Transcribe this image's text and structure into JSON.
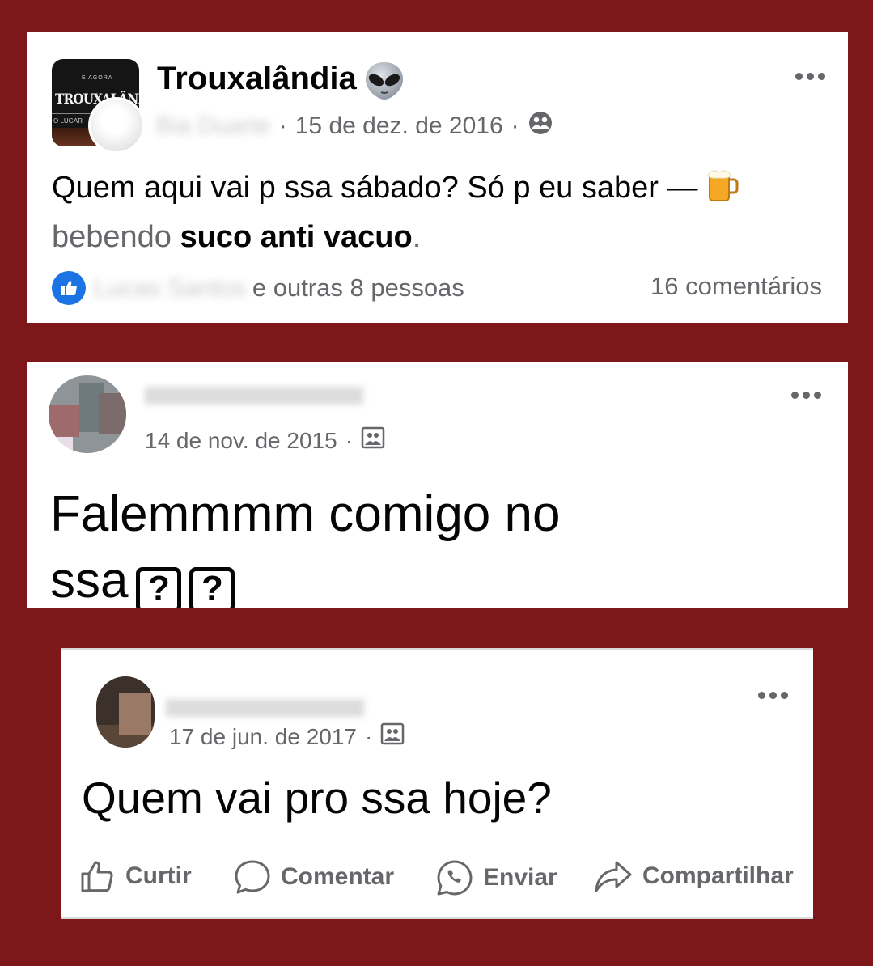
{
  "post1": {
    "page_name": "Trouxalândia",
    "page_emoji": "alien-emoji",
    "avatar_text": {
      "top": "E AGORA",
      "main": "TROUXALÂNDIA",
      "bottom": "O LUGAR"
    },
    "author": "Bia Duarte",
    "date": "15 de dez. de 2016",
    "separator": "·",
    "privacy_icon": "friends-icon",
    "text_main": "Quem aqui vai p ssa sábado? Só p eu saber —",
    "text_activity": "bebendo",
    "text_drink": "suco anti vacuo",
    "text_end": ".",
    "reactions_name": "Lucas Santos",
    "reactions_rest": "e outras 8 pessoas",
    "comments": "16 comentários"
  },
  "post2": {
    "date": "14 de nov. de 2015",
    "separator": "·",
    "privacy_icon": "group-icon",
    "text_line1": "Falemmmm comigo no",
    "text_line2": "ssa",
    "unknown_glyph": "?"
  },
  "post3": {
    "date": "17 de jun. de 2017",
    "separator": "·",
    "privacy_icon": "group-icon",
    "text": "Quem vai pro ssa hoje?",
    "actions": {
      "like": "Curtir",
      "comment": "Comentar",
      "send": "Enviar",
      "share": "Compartilhar"
    }
  },
  "colors": {
    "background": "#7d1719",
    "card": "#ffffff",
    "secondary_text": "#65676b",
    "like_blue": "#1b74e4"
  }
}
